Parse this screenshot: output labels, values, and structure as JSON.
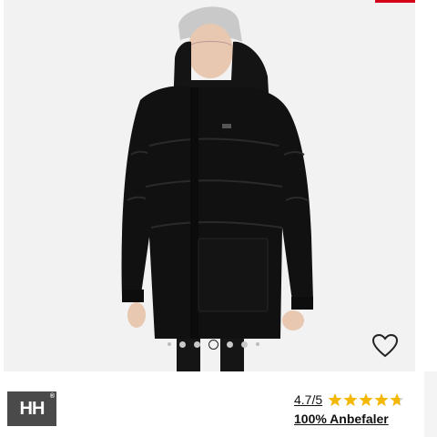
{
  "product": {
    "image_alt": "black long puffer jacket",
    "carousel": {
      "total": 7,
      "active": 3
    },
    "wishlist_icon": "heart-outline-icon"
  },
  "brand": {
    "logo_text": "HH",
    "registered_mark": "®"
  },
  "rating": {
    "value": "4.7/5",
    "stars": 4.7,
    "max_stars": 5,
    "star_color": "#f5b800",
    "recommend_text": "100% Anbefaler"
  },
  "colors": {
    "accent": "#d4001a",
    "logo_bg": "#4a4a4a",
    "photo_bg": "#f2f2f2"
  }
}
